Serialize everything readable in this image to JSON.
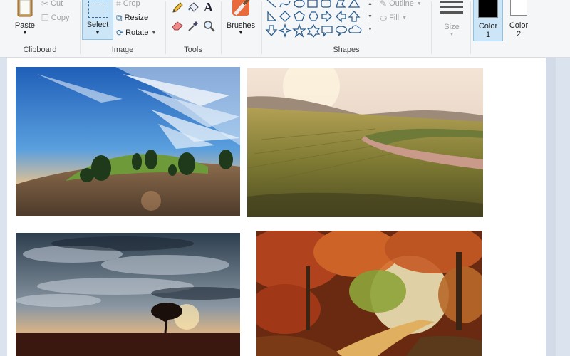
{
  "ribbon": {
    "clipboard": {
      "paste_label": "Paste",
      "cut_label": "Cut",
      "copy_label": "Copy",
      "group_label": "Clipboard"
    },
    "image": {
      "select_label": "Select",
      "crop_label": "Crop",
      "resize_label": "Resize",
      "rotate_label": "Rotate",
      "group_label": "Image"
    },
    "tools": {
      "text_tool_glyph": "A",
      "group_label": "Tools"
    },
    "brushes": {
      "label": "Brushes"
    },
    "shapes": {
      "outline_label": "Outline",
      "fill_label": "Fill",
      "group_label": "Shapes"
    },
    "size": {
      "label": "Size"
    },
    "colors": {
      "color1_label": "Color",
      "color1_number": "1",
      "color2_label": "Color",
      "color2_number": "2",
      "color1_value": "#000000",
      "color2_value": "#ffffff"
    }
  },
  "canvas": {
    "photos": [
      {
        "name": "sky-clouds-landscape-photo"
      },
      {
        "name": "sunset-field-road-photo"
      },
      {
        "name": "storm-clouds-tree-silhouette-photo"
      },
      {
        "name": "autumn-forest-path-photo"
      }
    ]
  },
  "colors": {
    "selection_bg": "#cde6f7",
    "selection_border": "#92c0e0",
    "ribbon_bg": "#f5f6f7",
    "workspace_bg": "#dbe3ee"
  }
}
